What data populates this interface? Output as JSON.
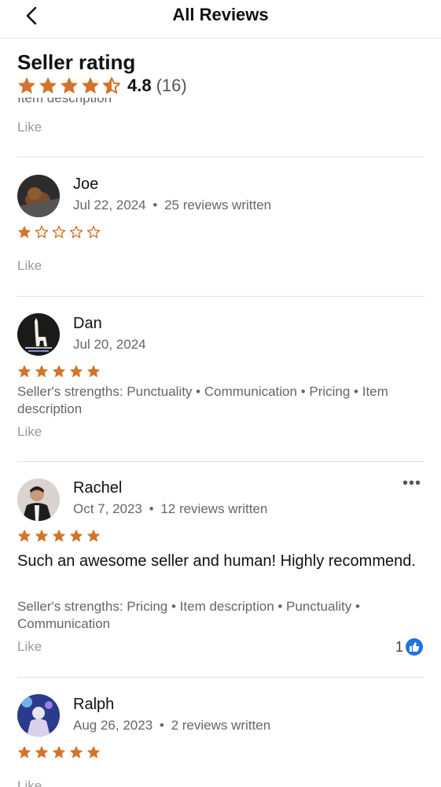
{
  "header": {
    "title": "All Reviews",
    "back_icon": "chevron-left-icon"
  },
  "seller_rating": {
    "title": "Seller rating",
    "value": "4.8",
    "count": "(16)",
    "stars_value": 4.5,
    "star_color": "#D3742A"
  },
  "partial_review": {
    "cut_text": "Item description",
    "like_label": "Like"
  },
  "reviews": [
    {
      "name": "Joe",
      "date": "Jul 22, 2024",
      "written": "25 reviews written",
      "stars": 1,
      "like_label": "Like"
    },
    {
      "name": "Dan",
      "date": "Jul 20, 2024",
      "stars": 5,
      "strengths": "Seller's strengths: Punctuality • Communication • Pricing • Item description",
      "like_label": "Like"
    },
    {
      "name": "Rachel",
      "date": "Oct 7, 2023",
      "written": "12 reviews written",
      "stars": 5,
      "comment": "Such an awesome seller and human! Highly recommend.",
      "strengths": "Seller's strengths: Pricing • Item description • Punctuality • Communication",
      "like_label": "Like",
      "like_count": "1",
      "more": "•••"
    },
    {
      "name": "Ralph",
      "date": "Aug 26, 2023",
      "written": "2 reviews written",
      "stars": 5,
      "like_label": "Like"
    }
  ],
  "separator": "•"
}
